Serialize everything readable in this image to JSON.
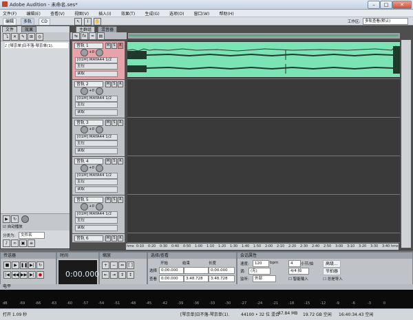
{
  "window": {
    "title": "Adobe Audition - 未命名.ses*"
  },
  "menu": [
    "文件(F)",
    "编辑(E)",
    "查看(V)",
    "视图(V)",
    "插入(I)",
    "效果(T)",
    "生成(G)",
    "选项(O)",
    "窗口(W)",
    "帮助(H)"
  ],
  "toolbar": {
    "modes": [
      "编辑",
      "多轨",
      "CD"
    ],
    "workspace_label": "工作区:",
    "workspace_value": "多轨查看(默认)"
  },
  "left_panel": {
    "tabs": [
      "文件",
      "效果"
    ],
    "file_item": "[琴京单]日不落-琴京单(1).",
    "auto_play": "自动播放",
    "sort_label": "分类为:",
    "sort_value": "文件名"
  },
  "main_tabs": [
    "主群组",
    "混音器"
  ],
  "tracks": [
    {
      "name": "音轨 1",
      "vol": "+0",
      "input": "[01M] MAYA44 1/2",
      "output": "主控",
      "mode": "读取"
    },
    {
      "name": "音轨 2",
      "vol": "+0",
      "input": "[01M] MAYA44 1/2",
      "output": "主控",
      "mode": "读取"
    },
    {
      "name": "音轨 3",
      "vol": "+0",
      "input": "[01M] MAYA44 1/2",
      "output": "主控",
      "mode": "读取"
    },
    {
      "name": "音轨 4",
      "vol": "+0",
      "input": "[01M] MAYA44 1/2",
      "output": "主控",
      "mode": "读取"
    },
    {
      "name": "音轨 5",
      "vol": "+0",
      "input": "[01M] MAYA44 1/2",
      "output": "主控",
      "mode": "读取"
    },
    {
      "name": "音轨 6"
    }
  ],
  "ruler": [
    "hms",
    "0:10",
    "0:20",
    "0:30",
    "0:40",
    "0:50",
    "1:00",
    "1:10",
    "1:20",
    "1:30",
    "1:40",
    "1:50",
    "2:00",
    "2:10",
    "2:20",
    "2:30",
    "2:40",
    "2:50",
    "3:00",
    "3:10",
    "3:20",
    "3:30",
    "3:40",
    "hms"
  ],
  "transport": {
    "title": "传送器"
  },
  "time": {
    "title": "时间",
    "value": "0:00.000"
  },
  "zoom": {
    "title": "缩放"
  },
  "selection": {
    "title": "选择/查看",
    "col_start": "开始",
    "col_end": "结束",
    "col_length": "长度",
    "row_sel": "选择",
    "row_view": "查看",
    "sel_start": "0:00.000",
    "sel_end": "",
    "sel_length": "0:00.000",
    "view_start": "0:00.000",
    "view_end": "3:48.728",
    "view_length": "3:48.728"
  },
  "session": {
    "title": "会话属性",
    "tempo_label": "速度:",
    "tempo": "120",
    "bpm": "bpm",
    "beats": "4",
    "beats_label": "小节/拍",
    "advanced": "高级...",
    "key_label": "调:",
    "key": "(无)",
    "time_sig": "4/4 拍",
    "metronome": "节拍器",
    "monitor_label": "监听:",
    "monitor": "外部",
    "smart_input": "智能输入",
    "always_import": "总是导入"
  },
  "level": {
    "title": "电平",
    "scale": [
      "dB",
      "-69",
      "-66",
      "-63",
      "-60",
      "-57",
      "-54",
      "-51",
      "-48",
      "-45",
      "-42",
      "-39",
      "-36",
      "-33",
      "-30",
      "-27",
      "-24",
      "-21",
      "-18",
      "-15",
      "-12",
      "-9",
      "-6",
      "-3",
      "0"
    ]
  },
  "status": {
    "open": "打开 1.09 秒",
    "file": "[琴京单]日不落-琴京单(1).",
    "format": "44100 • 32 位 混合",
    "size": "87.84 MB",
    "free": "19.72 GB 空闲",
    "duration": "16:40:34.43 空闲"
  }
}
